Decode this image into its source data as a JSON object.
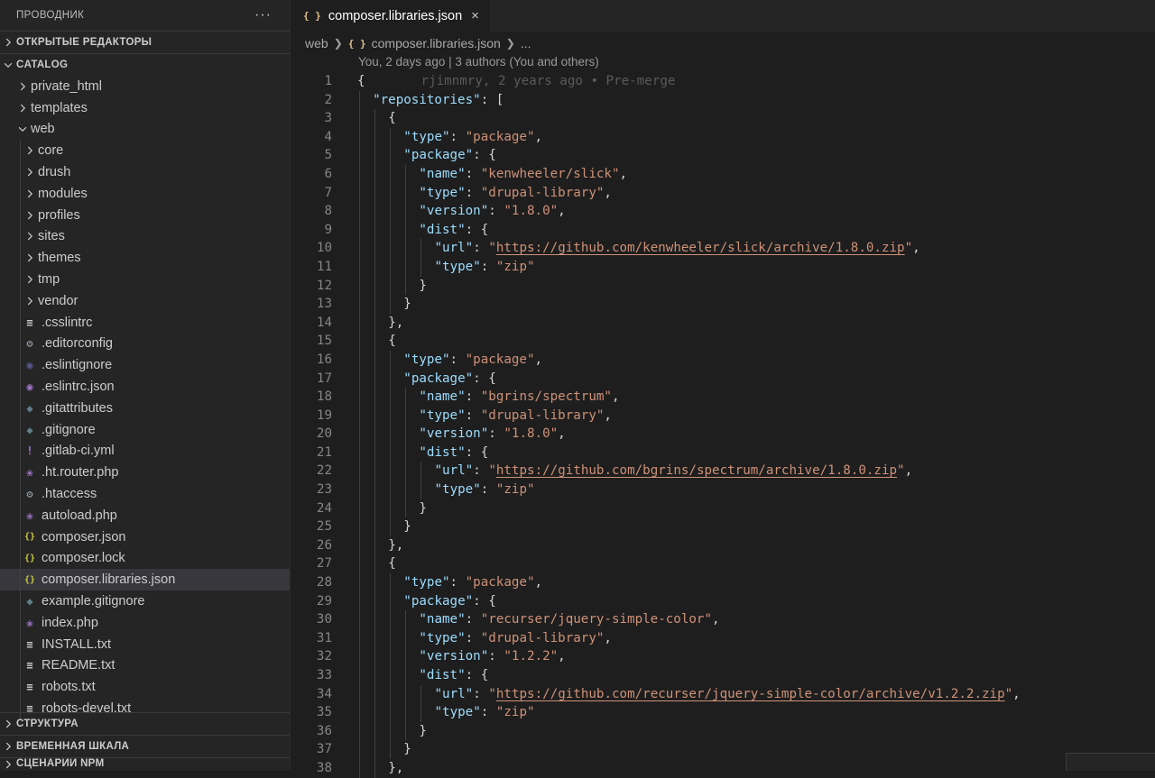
{
  "sidebar": {
    "title": "ПРОВОДНИК",
    "more": "···",
    "open_editors": "ОТКРЫТЫЕ РЕДАКТОРЫ",
    "project": "CATALOG",
    "tree": [
      {
        "label": "private_html",
        "type": "folder",
        "depth": 1,
        "icon": "chevron-right-icon"
      },
      {
        "label": "templates",
        "type": "folder",
        "depth": 1,
        "icon": "chevron-right-icon"
      },
      {
        "label": "web",
        "type": "folder",
        "depth": 1,
        "icon": "chevron-down-icon"
      },
      {
        "label": "core",
        "type": "folder",
        "depth": 2,
        "icon": "chevron-right-icon"
      },
      {
        "label": "drush",
        "type": "folder",
        "depth": 2,
        "icon": "chevron-right-icon"
      },
      {
        "label": "modules",
        "type": "folder",
        "depth": 2,
        "icon": "chevron-right-icon"
      },
      {
        "label": "profiles",
        "type": "folder",
        "depth": 2,
        "icon": "chevron-right-icon"
      },
      {
        "label": "sites",
        "type": "folder",
        "depth": 2,
        "icon": "chevron-right-icon"
      },
      {
        "label": "themes",
        "type": "folder",
        "depth": 2,
        "icon": "chevron-right-icon"
      },
      {
        "label": "tmp",
        "type": "folder",
        "depth": 2,
        "icon": "chevron-right-icon"
      },
      {
        "label": "vendor",
        "type": "folder",
        "depth": 2,
        "icon": "chevron-right-icon"
      },
      {
        "label": ".csslintrc",
        "type": "file",
        "depth": 2,
        "icon": "text-file-icon",
        "color": "#cccccc"
      },
      {
        "label": ".editorconfig",
        "type": "file",
        "depth": 2,
        "icon": "gear-icon",
        "color": "#9aa7b0"
      },
      {
        "label": ".eslintignore",
        "type": "file",
        "depth": 2,
        "icon": "eslint-icon",
        "color": "#5a5a8a"
      },
      {
        "label": ".eslintrc.json",
        "type": "file",
        "depth": 2,
        "icon": "eslint-icon",
        "color": "#a074c4"
      },
      {
        "label": ".gitattributes",
        "type": "file",
        "depth": 2,
        "icon": "git-icon",
        "color": "#5f7e8a"
      },
      {
        "label": ".gitignore",
        "type": "file",
        "depth": 2,
        "icon": "git-icon",
        "color": "#5f7e8a"
      },
      {
        "label": ".gitlab-ci.yml",
        "type": "file",
        "depth": 2,
        "icon": "yaml-icon",
        "color": "#a074c4"
      },
      {
        "label": ".ht.router.php",
        "type": "file",
        "depth": 2,
        "icon": "php-icon",
        "color": "#a074c4"
      },
      {
        "label": ".htaccess",
        "type": "file",
        "depth": 2,
        "icon": "gear-icon",
        "color": "#9aa7b0"
      },
      {
        "label": "autoload.php",
        "type": "file",
        "depth": 2,
        "icon": "php-icon",
        "color": "#a074c4"
      },
      {
        "label": "composer.json",
        "type": "file",
        "depth": 2,
        "icon": "json-icon",
        "color": "#cbcb41"
      },
      {
        "label": "composer.lock",
        "type": "file",
        "depth": 2,
        "icon": "json-icon",
        "color": "#cbcb41"
      },
      {
        "label": "composer.libraries.json",
        "type": "file",
        "depth": 2,
        "icon": "json-icon",
        "color": "#cbcb41",
        "selected": true
      },
      {
        "label": "example.gitignore",
        "type": "file",
        "depth": 2,
        "icon": "git-icon",
        "color": "#5f7e8a"
      },
      {
        "label": "index.php",
        "type": "file",
        "depth": 2,
        "icon": "php-icon",
        "color": "#a074c4"
      },
      {
        "label": "INSTALL.txt",
        "type": "file",
        "depth": 2,
        "icon": "text-file-icon",
        "color": "#cccccc"
      },
      {
        "label": "README.txt",
        "type": "file",
        "depth": 2,
        "icon": "text-file-icon",
        "color": "#cccccc"
      },
      {
        "label": "robots.txt",
        "type": "file",
        "depth": 2,
        "icon": "text-file-icon",
        "color": "#cccccc"
      },
      {
        "label": "robots-devel.txt",
        "type": "file",
        "depth": 2,
        "icon": "text-file-icon",
        "color": "#cccccc"
      }
    ],
    "bottom_sections": [
      "СТРУКТУРА",
      "ВРЕМЕННАЯ ШКАЛА",
      "СЦЕНАРИИ NPM"
    ]
  },
  "editor": {
    "tab_icon": "{ }",
    "tab_label": "composer.libraries.json",
    "close": "×",
    "breadcrumbs": [
      "web",
      "composer.libraries.json",
      "..."
    ],
    "codelens": "You, 2 days ago | 3 authors (You and others)",
    "blame": "rjimnmry, 2 years ago • Pre-merge",
    "lines": [
      {
        "n": "1",
        "i": 0,
        "t": [
          [
            "p",
            "{"
          ]
        ]
      },
      {
        "n": "2",
        "i": 1,
        "t": [
          [
            "k",
            "\"repositories\""
          ],
          [
            "p",
            ": ["
          ]
        ]
      },
      {
        "n": "3",
        "i": 2,
        "t": [
          [
            "p",
            "{"
          ]
        ]
      },
      {
        "n": "4",
        "i": 3,
        "t": [
          [
            "k",
            "\"type\""
          ],
          [
            "p",
            ": "
          ],
          [
            "s",
            "\"package\""
          ],
          [
            "p",
            ","
          ]
        ]
      },
      {
        "n": "5",
        "i": 3,
        "t": [
          [
            "k",
            "\"package\""
          ],
          [
            "p",
            ": {"
          ]
        ]
      },
      {
        "n": "6",
        "i": 4,
        "t": [
          [
            "k",
            "\"name\""
          ],
          [
            "p",
            ": "
          ],
          [
            "s",
            "\"kenwheeler/slick\""
          ],
          [
            "p",
            ","
          ]
        ]
      },
      {
        "n": "7",
        "i": 4,
        "t": [
          [
            "k",
            "\"type\""
          ],
          [
            "p",
            ": "
          ],
          [
            "s",
            "\"drupal-library\""
          ],
          [
            "p",
            ","
          ]
        ]
      },
      {
        "n": "8",
        "i": 4,
        "t": [
          [
            "k",
            "\"version\""
          ],
          [
            "p",
            ": "
          ],
          [
            "s",
            "\"1.8.0\""
          ],
          [
            "p",
            ","
          ]
        ]
      },
      {
        "n": "9",
        "i": 4,
        "t": [
          [
            "k",
            "\"dist\""
          ],
          [
            "p",
            ": {"
          ]
        ]
      },
      {
        "n": "10",
        "i": 5,
        "t": [
          [
            "k",
            "\"url\""
          ],
          [
            "p",
            ": "
          ],
          [
            "s",
            "\""
          ],
          [
            "u",
            "https://github.com/kenwheeler/slick/archive/1.8.0.zip"
          ],
          [
            "s",
            "\""
          ],
          [
            "p",
            ","
          ]
        ]
      },
      {
        "n": "11",
        "i": 5,
        "t": [
          [
            "k",
            "\"type\""
          ],
          [
            "p",
            ": "
          ],
          [
            "s",
            "\"zip\""
          ]
        ]
      },
      {
        "n": "12",
        "i": 4,
        "t": [
          [
            "p",
            "}"
          ]
        ]
      },
      {
        "n": "13",
        "i": 3,
        "t": [
          [
            "p",
            "}"
          ]
        ]
      },
      {
        "n": "14",
        "i": 2,
        "t": [
          [
            "p",
            "},"
          ]
        ]
      },
      {
        "n": "15",
        "i": 2,
        "t": [
          [
            "p",
            "{"
          ]
        ]
      },
      {
        "n": "16",
        "i": 3,
        "t": [
          [
            "k",
            "\"type\""
          ],
          [
            "p",
            ": "
          ],
          [
            "s",
            "\"package\""
          ],
          [
            "p",
            ","
          ]
        ]
      },
      {
        "n": "17",
        "i": 3,
        "t": [
          [
            "k",
            "\"package\""
          ],
          [
            "p",
            ": {"
          ]
        ]
      },
      {
        "n": "18",
        "i": 4,
        "t": [
          [
            "k",
            "\"name\""
          ],
          [
            "p",
            ": "
          ],
          [
            "s",
            "\"bgrins/spectrum\""
          ],
          [
            "p",
            ","
          ]
        ]
      },
      {
        "n": "19",
        "i": 4,
        "t": [
          [
            "k",
            "\"type\""
          ],
          [
            "p",
            ": "
          ],
          [
            "s",
            "\"drupal-library\""
          ],
          [
            "p",
            ","
          ]
        ]
      },
      {
        "n": "20",
        "i": 4,
        "t": [
          [
            "k",
            "\"version\""
          ],
          [
            "p",
            ": "
          ],
          [
            "s",
            "\"1.8.0\""
          ],
          [
            "p",
            ","
          ]
        ]
      },
      {
        "n": "21",
        "i": 4,
        "t": [
          [
            "k",
            "\"dist\""
          ],
          [
            "p",
            ": {"
          ]
        ]
      },
      {
        "n": "22",
        "i": 5,
        "t": [
          [
            "k",
            "\"url\""
          ],
          [
            "p",
            ": "
          ],
          [
            "s",
            "\""
          ],
          [
            "u",
            "https://github.com/bgrins/spectrum/archive/1.8.0.zip"
          ],
          [
            "s",
            "\""
          ],
          [
            "p",
            ","
          ]
        ]
      },
      {
        "n": "23",
        "i": 5,
        "t": [
          [
            "k",
            "\"type\""
          ],
          [
            "p",
            ": "
          ],
          [
            "s",
            "\"zip\""
          ]
        ]
      },
      {
        "n": "24",
        "i": 4,
        "t": [
          [
            "p",
            "}"
          ]
        ]
      },
      {
        "n": "25",
        "i": 3,
        "t": [
          [
            "p",
            "}"
          ]
        ]
      },
      {
        "n": "26",
        "i": 2,
        "t": [
          [
            "p",
            "},"
          ]
        ]
      },
      {
        "n": "27",
        "i": 2,
        "t": [
          [
            "p",
            "{"
          ]
        ]
      },
      {
        "n": "28",
        "i": 3,
        "t": [
          [
            "k",
            "\"type\""
          ],
          [
            "p",
            ": "
          ],
          [
            "s",
            "\"package\""
          ],
          [
            "p",
            ","
          ]
        ]
      },
      {
        "n": "29",
        "i": 3,
        "t": [
          [
            "k",
            "\"package\""
          ],
          [
            "p",
            ": {"
          ]
        ]
      },
      {
        "n": "30",
        "i": 4,
        "t": [
          [
            "k",
            "\"name\""
          ],
          [
            "p",
            ": "
          ],
          [
            "s",
            "\"recurser/jquery-simple-color\""
          ],
          [
            "p",
            ","
          ]
        ]
      },
      {
        "n": "31",
        "i": 4,
        "t": [
          [
            "k",
            "\"type\""
          ],
          [
            "p",
            ": "
          ],
          [
            "s",
            "\"drupal-library\""
          ],
          [
            "p",
            ","
          ]
        ]
      },
      {
        "n": "32",
        "i": 4,
        "t": [
          [
            "k",
            "\"version\""
          ],
          [
            "p",
            ": "
          ],
          [
            "s",
            "\"1.2.2\""
          ],
          [
            "p",
            ","
          ]
        ]
      },
      {
        "n": "33",
        "i": 4,
        "t": [
          [
            "k",
            "\"dist\""
          ],
          [
            "p",
            ": {"
          ]
        ]
      },
      {
        "n": "34",
        "i": 5,
        "t": [
          [
            "k",
            "\"url\""
          ],
          [
            "p",
            ": "
          ],
          [
            "s",
            "\""
          ],
          [
            "u",
            "https://github.com/recurser/jquery-simple-color/archive/v1.2.2.zip"
          ],
          [
            "s",
            "\""
          ],
          [
            "p",
            ","
          ]
        ]
      },
      {
        "n": "35",
        "i": 5,
        "t": [
          [
            "k",
            "\"type\""
          ],
          [
            "p",
            ": "
          ],
          [
            "s",
            "\"zip\""
          ]
        ]
      },
      {
        "n": "36",
        "i": 4,
        "t": [
          [
            "p",
            "}"
          ]
        ]
      },
      {
        "n": "37",
        "i": 3,
        "t": [
          [
            "p",
            "}"
          ]
        ]
      },
      {
        "n": "38",
        "i": 2,
        "t": [
          [
            "p",
            "},"
          ]
        ]
      }
    ]
  },
  "colors": {
    "key": "#9cdcfe",
    "string": "#ce9178",
    "punct": "#d4d4d4",
    "line_number": "#858585",
    "selection": "#37373d"
  }
}
